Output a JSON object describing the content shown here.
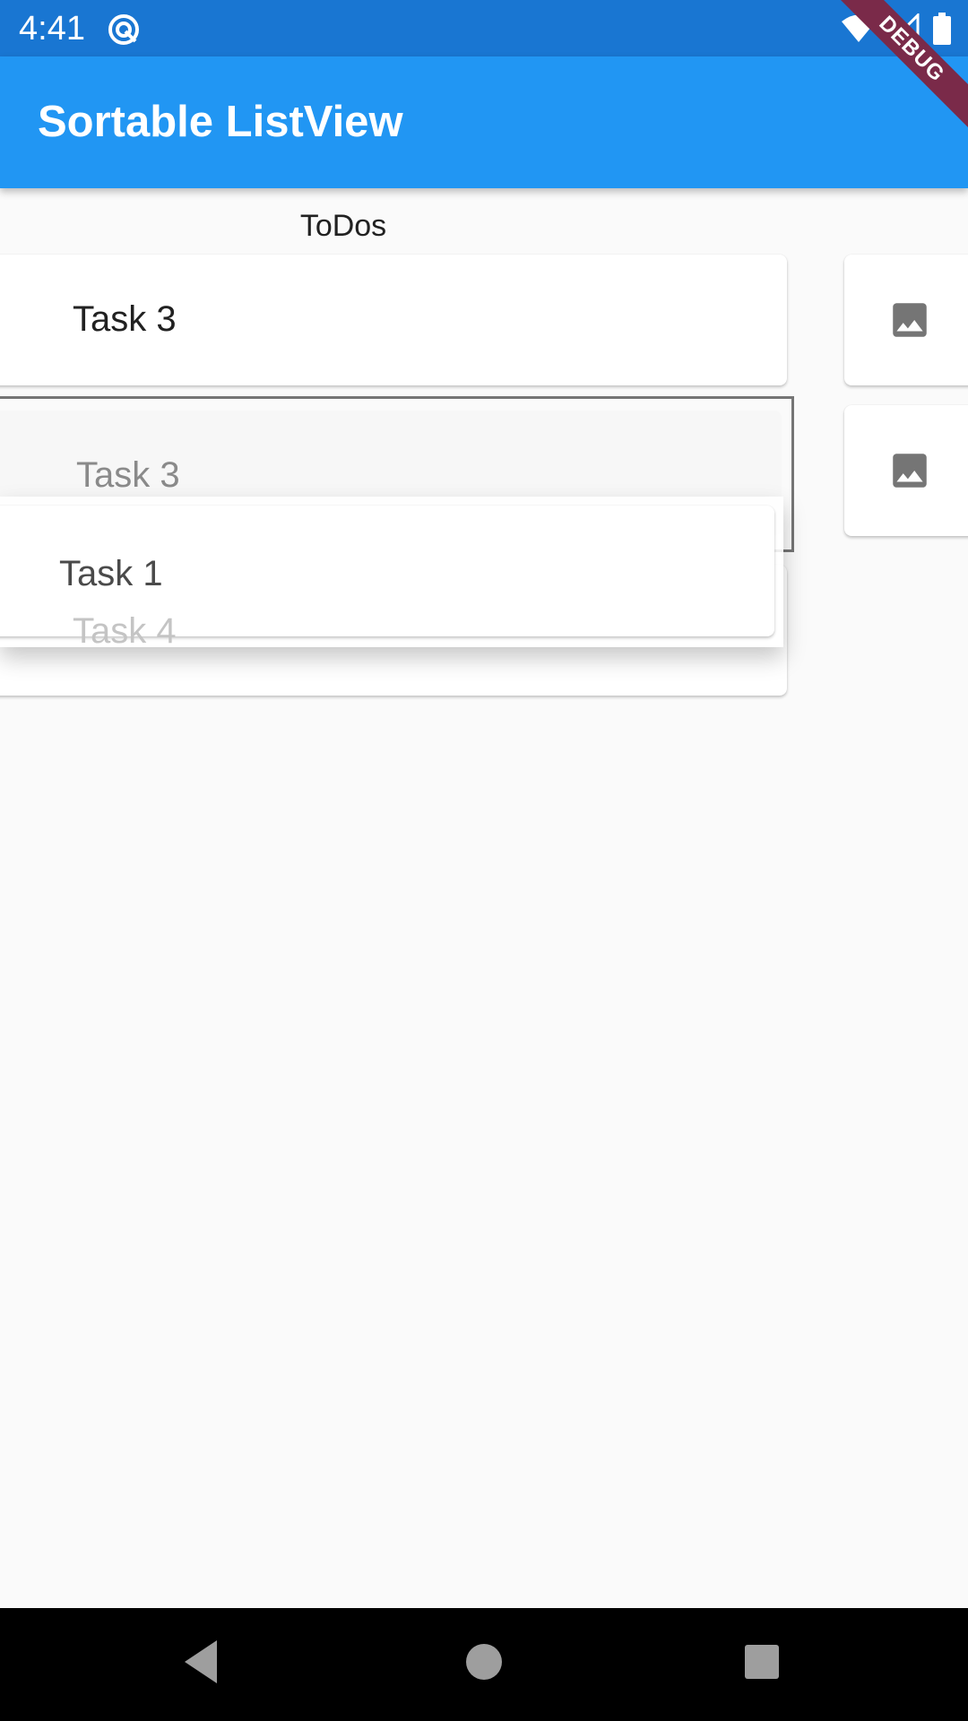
{
  "status_bar": {
    "time": "4:41",
    "icons": [
      "app-notification-icon",
      "wifi-icon",
      "signal-icon",
      "battery-icon"
    ],
    "background_color": "#1976d2"
  },
  "app_bar": {
    "title": "Sortable ListView",
    "background_color": "#2196f3",
    "debug_banner": "DEBUG"
  },
  "list": {
    "header": "ToDos",
    "items": [
      {
        "label": "Task 3",
        "state": "normal"
      },
      {
        "label": "Task 3",
        "state": "placeholder"
      },
      {
        "label": "Task 1",
        "state": "dragging"
      },
      {
        "label": "Task 4",
        "state": "faded"
      }
    ]
  },
  "side_list": {
    "items": [
      {
        "icon": "image-icon"
      },
      {
        "icon": "image-icon"
      }
    ]
  },
  "nav_bar": {
    "buttons": [
      "back-icon",
      "home-icon",
      "recents-icon"
    ]
  }
}
